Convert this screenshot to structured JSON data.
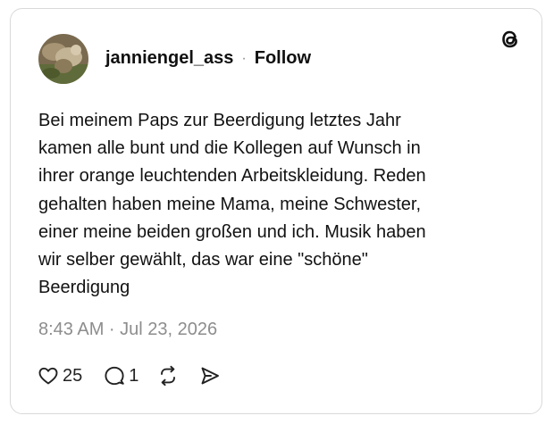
{
  "author": {
    "username": "janniengel_ass",
    "separator": "·",
    "follow_label": "Follow",
    "avatar_icon": "profile-photo"
  },
  "post": {
    "text": "Bei meinem Paps zur Beerdigung letztes Jahr\nkamen alle bunt und die Kollegen auf Wunsch in\nihrer orange leuchtenden Arbeitskleidung. Reden\ngehalten haben meine Mama, meine Schwester,\neiner meine beiden großen und ich. Musik haben\nwir selber gewählt, das war eine \"schöne\"\nBeerdigung",
    "timestamp": "8:43 AM · Jul 23, 2026"
  },
  "actions": {
    "likes": "25",
    "replies": "1",
    "like_icon": "heart-icon",
    "reply_icon": "speech-bubble-icon",
    "repost_icon": "repost-icon",
    "share_icon": "send-icon"
  },
  "brand": {
    "logo_icon": "threads-logo-icon"
  },
  "colors": {
    "text": "#101010",
    "muted": "#8d8d8d",
    "border": "#d9d9d9"
  }
}
